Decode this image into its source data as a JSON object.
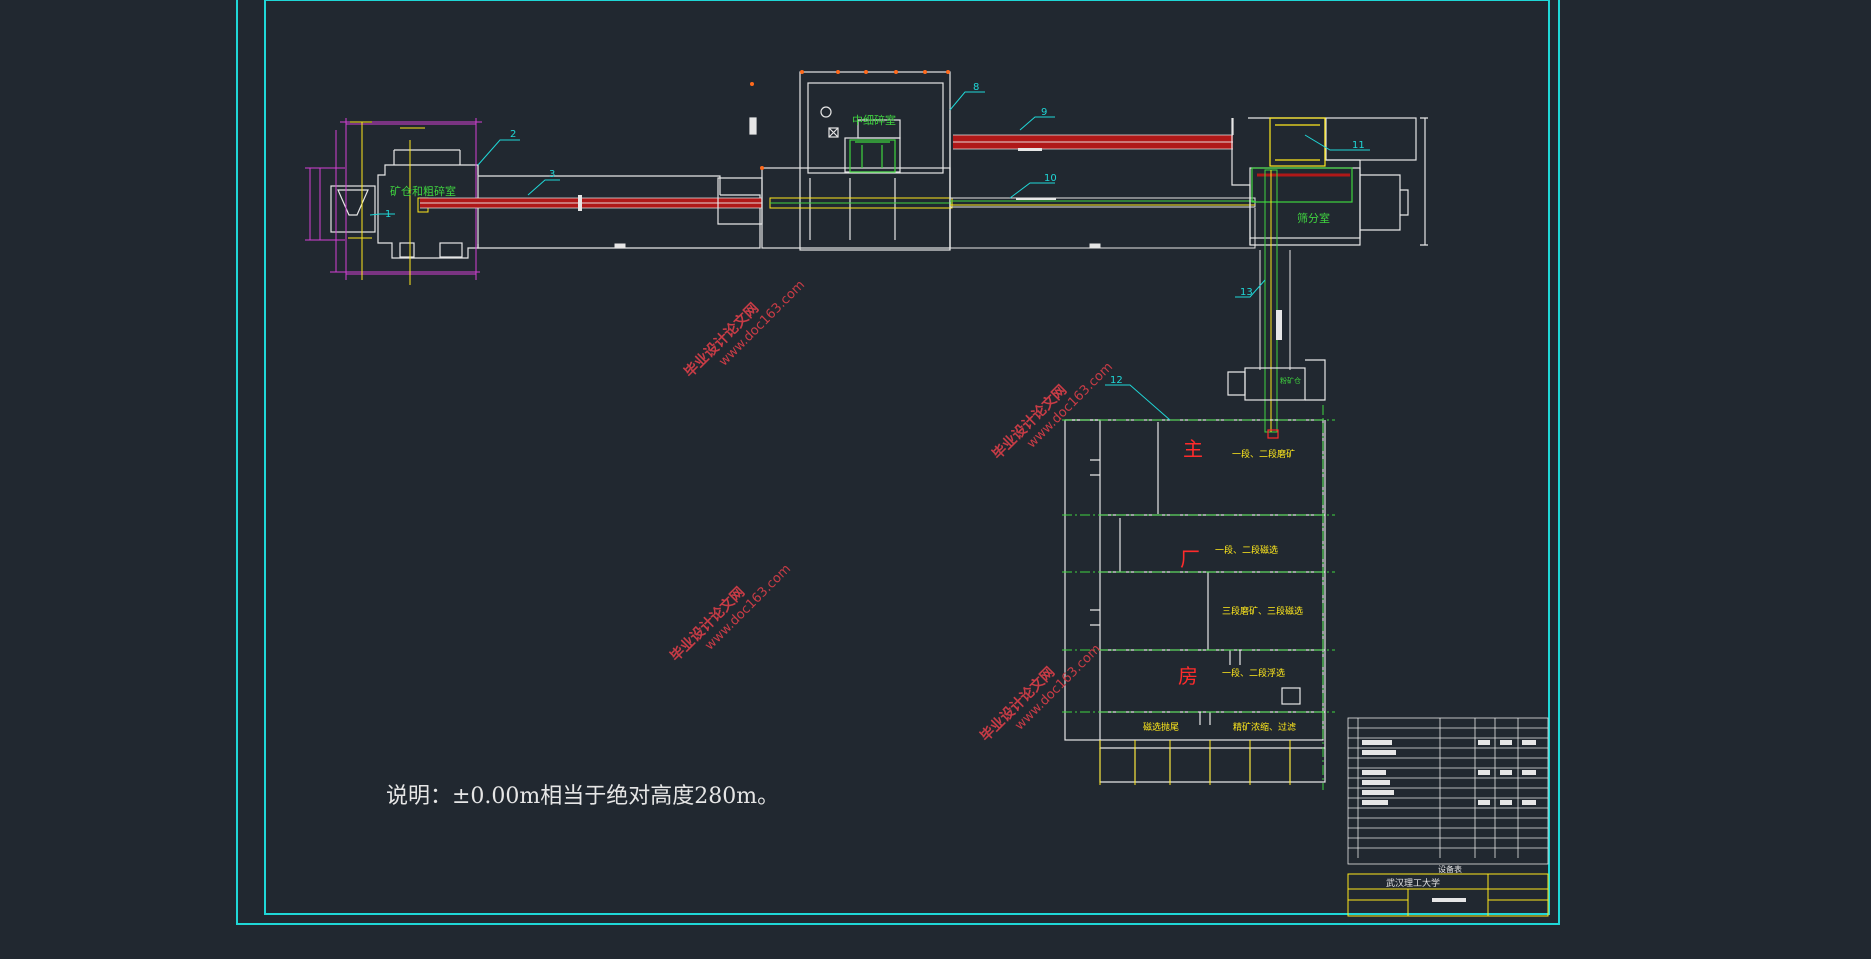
{
  "colors": {
    "background": "#212830",
    "frame": "#1fd7d7",
    "wall": "#e6e6e6",
    "conveyor": "#b01818",
    "green": "#3fd43f",
    "yellow": "#ffe81c",
    "magenta": "#d43fd4",
    "red": "#ff2b2b",
    "watermark": "#c83c46"
  },
  "rooms": {
    "crusher": "矿仓和粗碎室",
    "medium_crush": "中细碎室",
    "screening": "筛分室",
    "powder_bin": "粉矿仓",
    "mill_1": "一段、二段磨矿",
    "mag_1": "一段、二段磁选",
    "mill_3": "三段磨矿、三段磁选",
    "flot": "一段、二段浮选",
    "mag_tail": "磁选抛尾",
    "filter": "精矿浓缩、过滤"
  },
  "main_plant_chars": [
    "主",
    "厂",
    "房"
  ],
  "callouts": [
    "1",
    "2",
    "3",
    "8",
    "9",
    "10",
    "11",
    "13",
    "12"
  ],
  "watermark_text": [
    "毕业设计论文网",
    "www.doc163.com"
  ],
  "note": "说明：±0.00m相当于绝对高度280m。",
  "title_block": {
    "table_name": "设备表",
    "school": "武汉理工大学"
  }
}
